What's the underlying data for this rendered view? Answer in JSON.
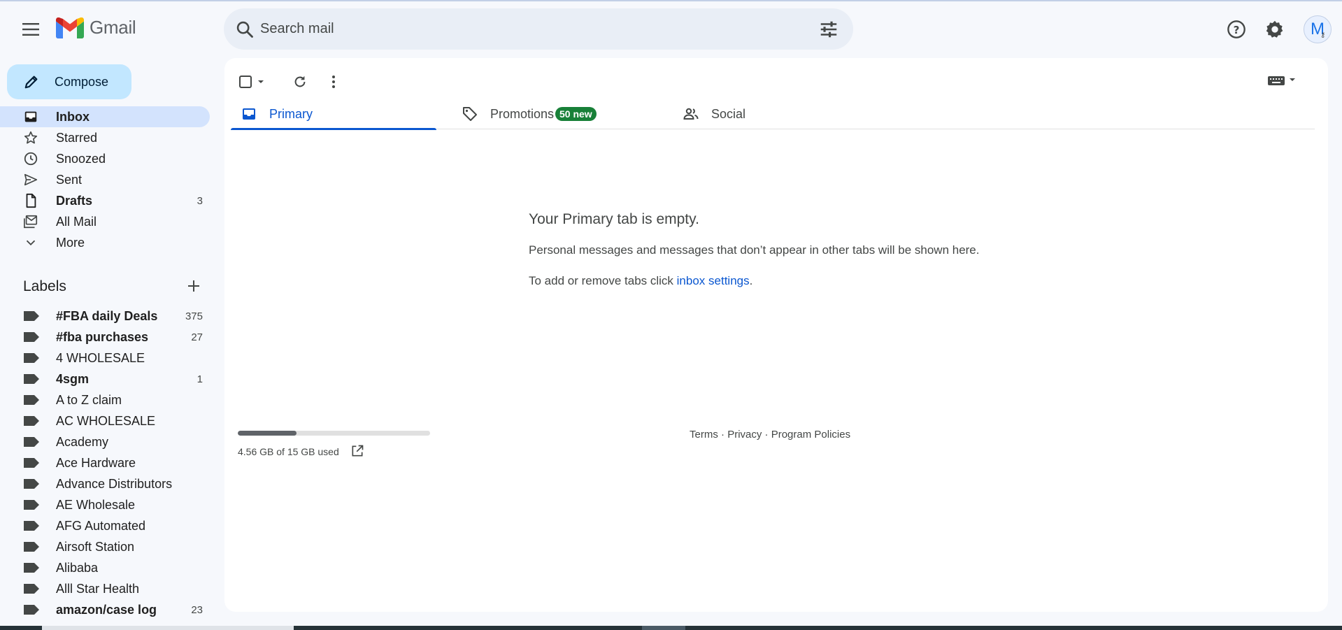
{
  "header": {
    "logo_text": "Gmail",
    "search_placeholder": "Search mail",
    "avatar_initial": "M"
  },
  "sidebar": {
    "compose_label": "Compose",
    "items": [
      {
        "label": "Inbox",
        "count": "",
        "bold": true,
        "active": true,
        "icon": "inbox-icon"
      },
      {
        "label": "Starred",
        "count": "",
        "bold": false,
        "active": false,
        "icon": "star-icon"
      },
      {
        "label": "Snoozed",
        "count": "",
        "bold": false,
        "active": false,
        "icon": "clock-icon"
      },
      {
        "label": "Sent",
        "count": "",
        "bold": false,
        "active": false,
        "icon": "send-icon"
      },
      {
        "label": "Drafts",
        "count": "3",
        "bold": true,
        "active": false,
        "icon": "draft-icon"
      },
      {
        "label": "All Mail",
        "count": "",
        "bold": false,
        "active": false,
        "icon": "all-mail-icon"
      },
      {
        "label": "More",
        "count": "",
        "bold": false,
        "active": false,
        "icon": "chevron-down-icon"
      }
    ],
    "labels_title": "Labels",
    "labels": [
      {
        "label": "#FBA daily Deals",
        "count": "375",
        "bold": true
      },
      {
        "label": "#fba purchases",
        "count": "27",
        "bold": true
      },
      {
        "label": "4 WHOLESALE",
        "count": "",
        "bold": false
      },
      {
        "label": "4sgm",
        "count": "1",
        "bold": true
      },
      {
        "label": "A to Z claim",
        "count": "",
        "bold": false
      },
      {
        "label": "AC WHOLESALE",
        "count": "",
        "bold": false
      },
      {
        "label": "Academy",
        "count": "",
        "bold": false
      },
      {
        "label": "Ace Hardware",
        "count": "",
        "bold": false
      },
      {
        "label": "Advance Distributors",
        "count": "",
        "bold": false
      },
      {
        "label": "AE Wholesale",
        "count": "",
        "bold": false
      },
      {
        "label": "AFG Automated",
        "count": "",
        "bold": false
      },
      {
        "label": "Airsoft Station",
        "count": "",
        "bold": false
      },
      {
        "label": "Alibaba",
        "count": "",
        "bold": false
      },
      {
        "label": "Alll Star Health",
        "count": "",
        "bold": false
      },
      {
        "label": "amazon/case log",
        "count": "23",
        "bold": true
      }
    ]
  },
  "tabs": [
    {
      "label": "Primary",
      "icon": "inbox-tab-icon",
      "active": true
    },
    {
      "label": "Promotions",
      "icon": "tag-icon",
      "active": false,
      "badge": "50 new"
    },
    {
      "label": "Social",
      "icon": "people-icon",
      "active": false
    }
  ],
  "main": {
    "empty_title": "Your Primary tab is empty.",
    "empty_desc": "Personal messages and messages that don’t appear in other tabs will be shown here.",
    "settings_prefix": "To add or remove tabs click ",
    "settings_link": "inbox settings",
    "settings_suffix": "."
  },
  "storage": {
    "text": "4.56 GB of 15 GB used",
    "fraction_used": 0.304
  },
  "footer": {
    "terms": "Terms",
    "sep1": " · ",
    "privacy": "Privacy",
    "sep2": " · ",
    "policies": "Program Policies"
  },
  "colors": {
    "accent": "#0b57d0",
    "compose_bg": "#c2e7ff",
    "active_nav_bg": "#d3e3fd",
    "badge_green": "#188038"
  }
}
